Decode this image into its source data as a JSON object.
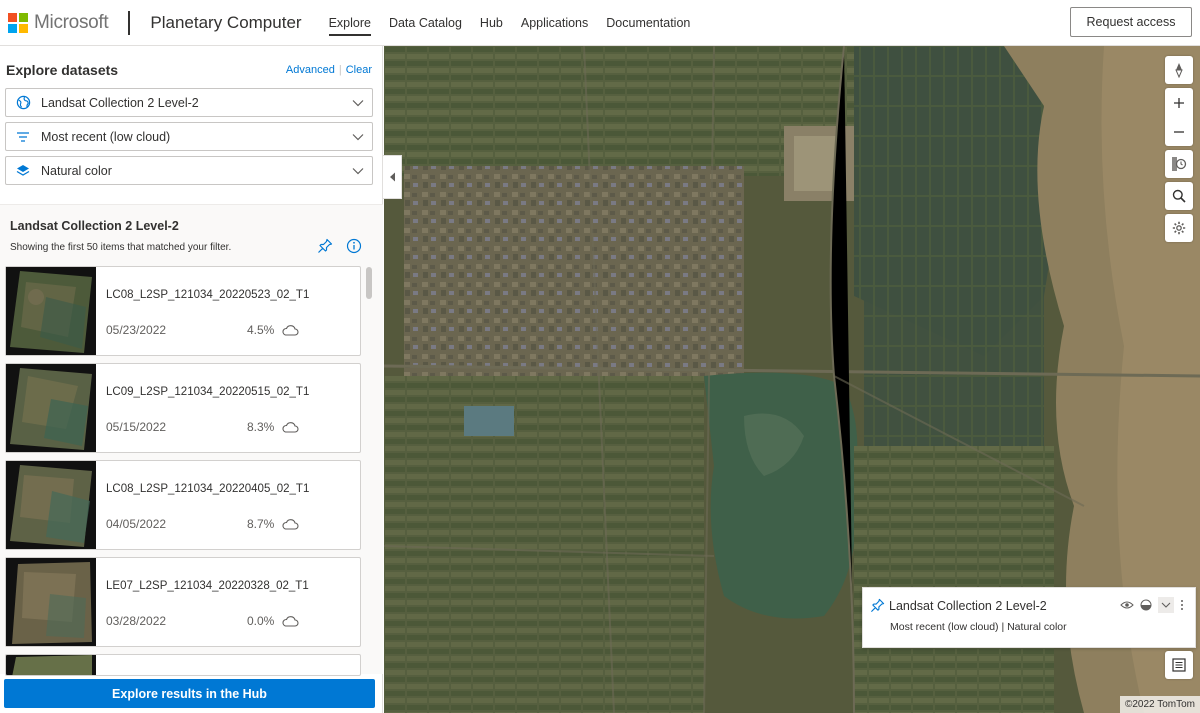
{
  "header": {
    "ms_logo_text": "Microsoft",
    "product": "Planetary Computer",
    "nav": [
      "Explore",
      "Data Catalog",
      "Hub",
      "Applications",
      "Documentation"
    ],
    "active_nav": "Explore",
    "request_access": "Request access"
  },
  "panel": {
    "title": "Explore datasets",
    "advanced_link": "Advanced",
    "clear_link": "Clear",
    "dropdowns": [
      {
        "label": "Landsat Collection 2 Level-2",
        "icon": "globe-icon"
      },
      {
        "label": "Most recent (low cloud)",
        "icon": "filter-icon"
      },
      {
        "label": "Natural color",
        "icon": "layers-icon"
      }
    ],
    "results_title": "Landsat Collection 2 Level-2",
    "results_subtitle": "Showing the first 50 items that matched your filter.",
    "items": [
      {
        "id": "LC08_L2SP_121034_20220523_02_T1",
        "date": "05/23/2022",
        "cloud": "4.5%"
      },
      {
        "id": "LC09_L2SP_121034_20220515_02_T1",
        "date": "05/15/2022",
        "cloud": "8.3%"
      },
      {
        "id": "LC08_L2SP_121034_20220405_02_T1",
        "date": "04/05/2022",
        "cloud": "8.7%"
      },
      {
        "id": "LE07_L2SP_121034_20220328_02_T1",
        "date": "03/28/2022",
        "cloud": "0.0%"
      }
    ],
    "hub_button": "Explore results in the Hub"
  },
  "map": {
    "legend_title": "Landsat Collection 2 Level-2",
    "legend_subtitle": "Most recent (low cloud) | Natural color",
    "attribution": "©2022 TomTom"
  },
  "colors": {
    "accent": "#0078d4",
    "ms_red": "#f25022",
    "ms_green": "#7fba00",
    "ms_blue": "#00a4ef",
    "ms_yellow": "#ffb900"
  }
}
